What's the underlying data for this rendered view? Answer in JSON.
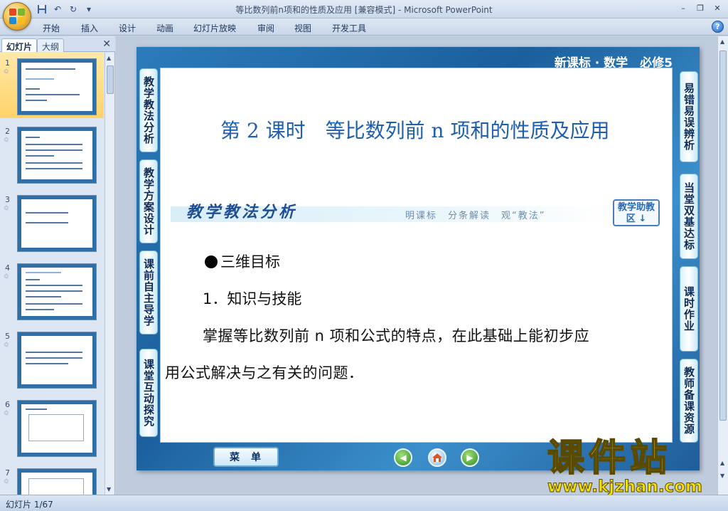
{
  "window": {
    "title": "等比数列前n项和的性质及应用 [兼容模式] - Microsoft PowerPoint"
  },
  "ribbon": {
    "tabs": [
      "开始",
      "插入",
      "设计",
      "动画",
      "幻灯片放映",
      "审阅",
      "视图",
      "开发工具"
    ]
  },
  "left_panel": {
    "tab_slides": "幻灯片",
    "tab_outline": "大纲",
    "thumbnails": [
      "1",
      "2",
      "3",
      "4",
      "5",
      "6",
      "7"
    ],
    "selected": "1"
  },
  "slide": {
    "header": "新课标 · 数学　必修5",
    "left_nav": [
      "教学教法分析",
      "教学方案设计",
      "课前自主导学",
      "课堂互动探究"
    ],
    "right_nav": [
      "易错易误辨析",
      "当堂双基达标",
      "课时作业",
      "教师备课资源"
    ],
    "title": "第 2 课时　等比数列前 n 项和的性质及应用",
    "banner_label": "教学教法分析",
    "banner_motto": "明课标　分条解读　观“教法”",
    "banner_button": "教学助教区",
    "bullet": "三维目标",
    "subheading": "1．知识与技能",
    "paragraph_line1": "掌握等比数列前 n 项和公式的特点，在此基础上能初步应",
    "paragraph_line2": "用公式解决与之有关的问题．",
    "menu_button": "菜单"
  },
  "watermark": {
    "brand": "课件站",
    "url": "www.kjzhan.com"
  },
  "status": {
    "slide_indicator": "幻灯片 1/67"
  },
  "colors": {
    "slide_blue": "#2c7bbb",
    "title_blue": "#1d5fb0",
    "selection": "#ffd36a",
    "watermark_yellow": "#f6e400"
  }
}
